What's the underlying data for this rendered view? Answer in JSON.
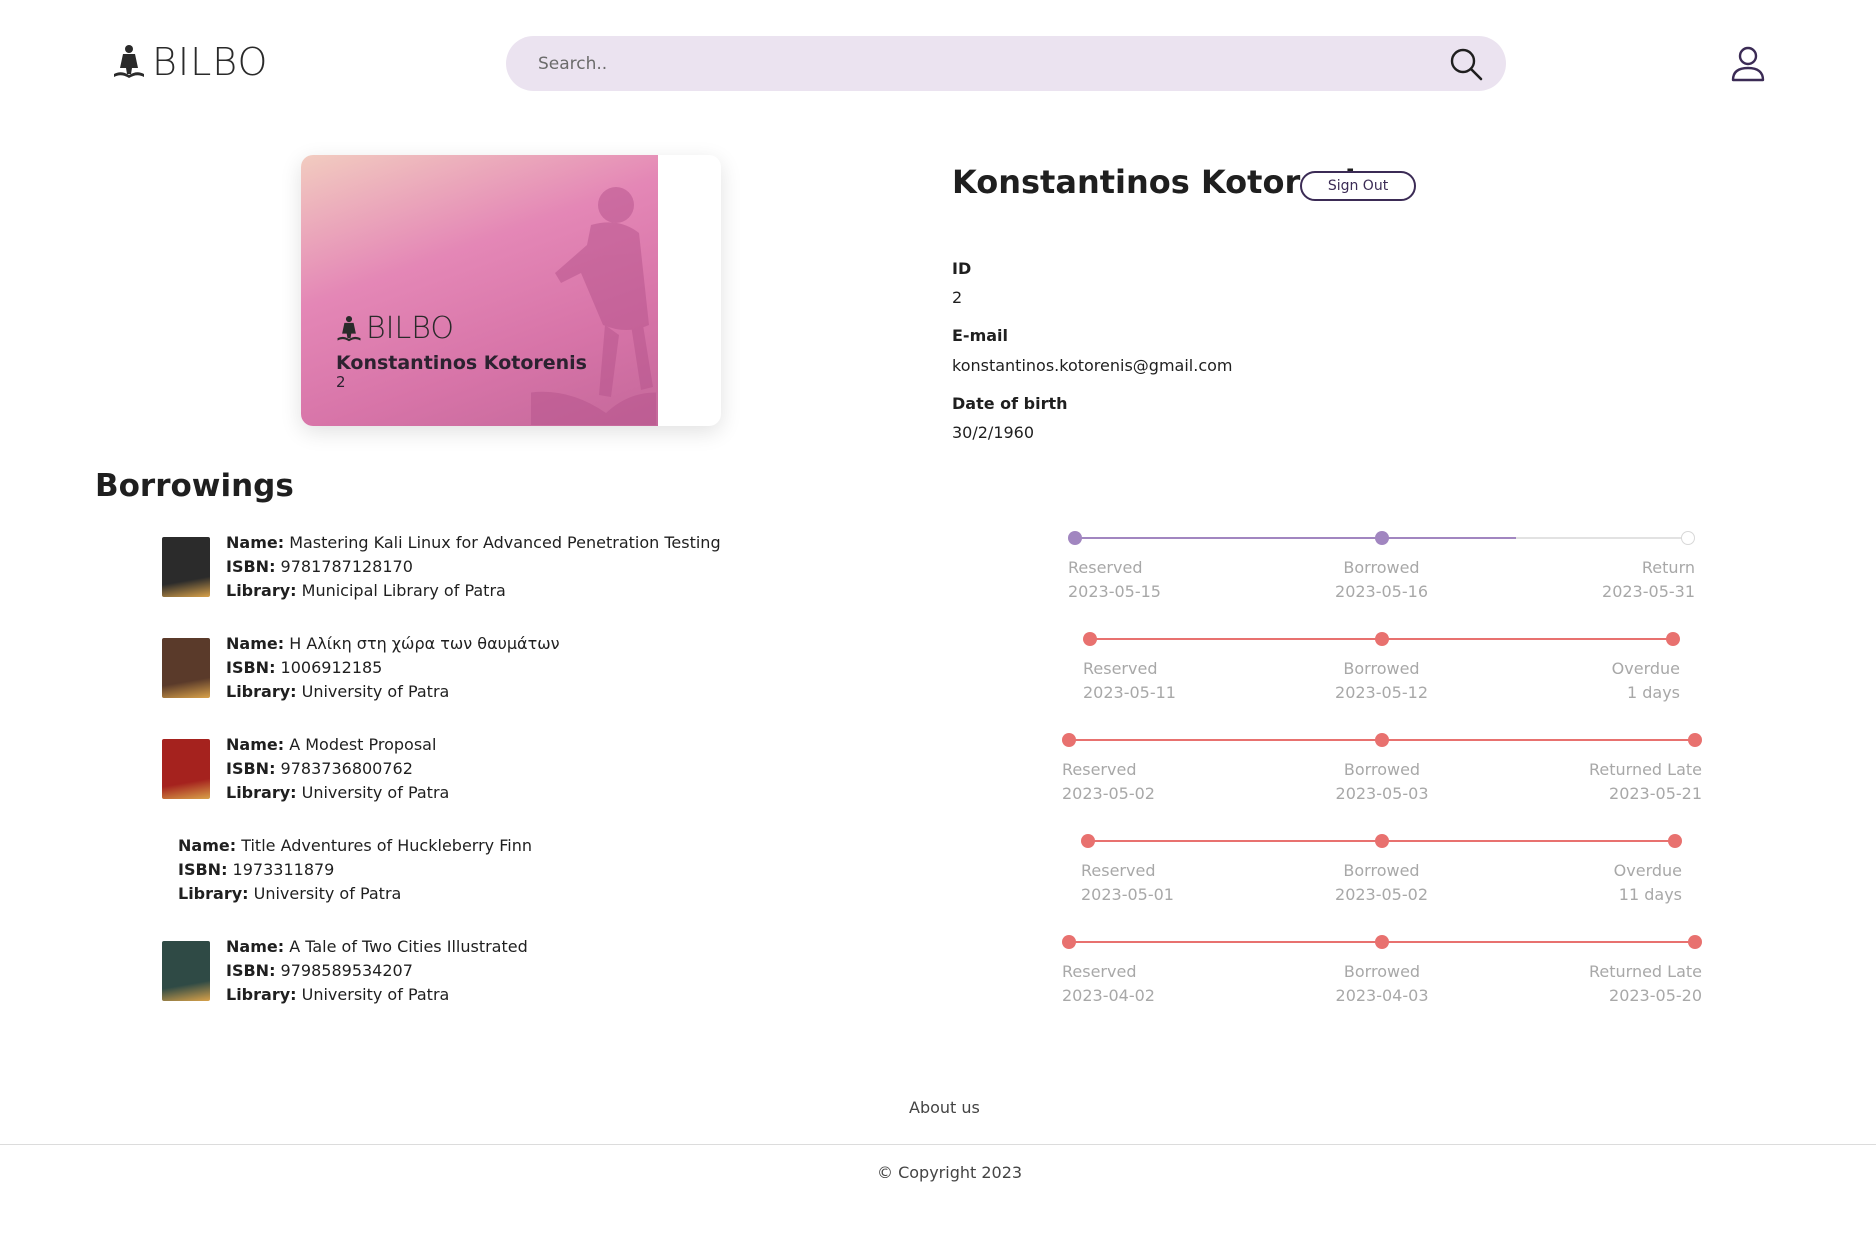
{
  "header": {
    "logo_text": "BILBO",
    "search_placeholder": "Search.."
  },
  "library_card": {
    "logo_text": "BILBO",
    "name": "Konstantinos Kotorenis",
    "id": "2"
  },
  "profile": {
    "name": "Konstantinos Kotorenis",
    "sign_out_label": "Sign Out",
    "fields": [
      {
        "label": "ID",
        "value": "2"
      },
      {
        "label": "E-mail",
        "value": "konstantinos.kotorenis@gmail.com"
      },
      {
        "label": "Date of birth",
        "value": "30/2/1960"
      }
    ]
  },
  "borrowings": {
    "title": "Borrowings",
    "name_label": "Name:",
    "isbn_label": "ISBN:",
    "library_label": "Library:",
    "items": [
      {
        "name": "Mastering Kali Linux for Advanced Penetration Testing",
        "isbn": "9781787128170",
        "library": "Municipal Library of Patra",
        "has_cover": true,
        "cover_color": "#2b2b2b",
        "timeline": {
          "color": "#a186c0",
          "progress": 0.72,
          "stages": [
            {
              "label": "Reserved",
              "value": "2023-05-15"
            },
            {
              "label": "Borrowed",
              "value": "2023-05-16"
            },
            {
              "label": "Return",
              "value": "2023-05-31"
            }
          ]
        }
      },
      {
        "name": "Η Αλίκη στη χώρα των θαυμάτων",
        "isbn": "1006912185",
        "library": "University of Patra",
        "has_cover": true,
        "cover_color": "#5a3a2a",
        "timeline": {
          "color": "#e8716f",
          "progress": 1,
          "stages": [
            {
              "label": "Reserved",
              "value": "2023-05-11"
            },
            {
              "label": "Borrowed",
              "value": "2023-05-12"
            },
            {
              "label": "Overdue",
              "value": "1 days"
            }
          ]
        }
      },
      {
        "name": "A Modest Proposal",
        "isbn": "9783736800762",
        "library": "University of Patra",
        "has_cover": true,
        "cover_color": "#a5221e",
        "timeline": {
          "color": "#e8716f",
          "progress": 1,
          "stages": [
            {
              "label": "Reserved",
              "value": "2023-05-02"
            },
            {
              "label": "Borrowed",
              "value": "2023-05-03"
            },
            {
              "label": "Returned Late",
              "value": "2023-05-21"
            }
          ]
        }
      },
      {
        "name": "Title Adventures of Huckleberry Finn",
        "isbn": "1973311879",
        "library": "University of Patra",
        "has_cover": false,
        "cover_color": "",
        "timeline": {
          "color": "#e8716f",
          "progress": 1,
          "stages": [
            {
              "label": "Reserved",
              "value": "2023-05-01"
            },
            {
              "label": "Borrowed",
              "value": "2023-05-02"
            },
            {
              "label": "Overdue",
              "value": "11 days"
            }
          ]
        }
      },
      {
        "name": "A Tale of Two Cities Illustrated",
        "isbn": "9798589534207",
        "library": "University of Patra",
        "has_cover": true,
        "cover_color": "#2f4a45",
        "timeline": {
          "color": "#e8716f",
          "progress": 1,
          "stages": [
            {
              "label": "Reserved",
              "value": "2023-04-02"
            },
            {
              "label": "Borrowed",
              "value": "2023-04-03"
            },
            {
              "label": "Returned Late",
              "value": "2023-05-20"
            }
          ]
        }
      }
    ]
  },
  "footer": {
    "about_label": "About us",
    "copyright": "© Copyright 2023"
  }
}
